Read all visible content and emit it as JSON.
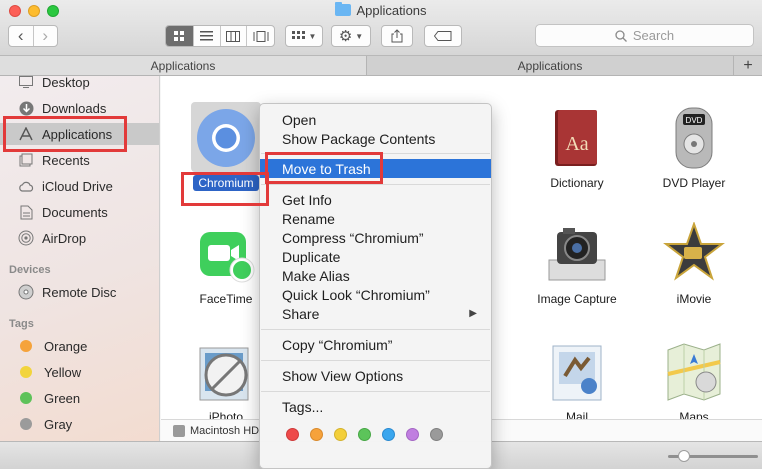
{
  "window": {
    "title": "Applications"
  },
  "toolbar": {
    "search_placeholder": "Search",
    "back_label": "‹",
    "forward_label": "›"
  },
  "tabs": [
    {
      "label": "Applications",
      "active": true
    },
    {
      "label": "Applications",
      "active": false
    }
  ],
  "tab_add_label": "+",
  "sidebar": {
    "favorites": [
      {
        "label": "Desktop",
        "icon": "desktop-icon"
      },
      {
        "label": "Downloads",
        "icon": "downloads-icon"
      },
      {
        "label": "Applications",
        "icon": "applications-icon",
        "selected": true
      },
      {
        "label": "Recents",
        "icon": "recents-icon"
      },
      {
        "label": "iCloud Drive",
        "icon": "cloud-icon"
      },
      {
        "label": "Documents",
        "icon": "documents-icon"
      },
      {
        "label": "AirDrop",
        "icon": "airdrop-icon"
      }
    ],
    "devices_heading": "Devices",
    "devices": [
      {
        "label": "Remote Disc",
        "icon": "disc-icon"
      }
    ],
    "tags_heading": "Tags",
    "tags": [
      {
        "label": "Orange",
        "color": "#f5a33b"
      },
      {
        "label": "Yellow",
        "color": "#f2d43c"
      },
      {
        "label": "Green",
        "color": "#5ec25a"
      },
      {
        "label": "Gray",
        "color": "#9b9b9b"
      }
    ]
  },
  "apps": [
    {
      "label": "Chromium",
      "selected": true
    },
    {
      "label": "Dictionary"
    },
    {
      "label": "DVD Player"
    },
    {
      "label": "FaceTime"
    },
    {
      "label": "Image Capture"
    },
    {
      "label": "iMovie"
    },
    {
      "label": "iPhoto"
    },
    {
      "label": "Mail"
    },
    {
      "label": "Maps"
    }
  ],
  "pathbar": {
    "disk": "Macintosh HD"
  },
  "context_menu": {
    "items": [
      {
        "label": "Open"
      },
      {
        "label": "Show Package Contents"
      },
      {
        "label": "Move to Trash",
        "highlighted": true
      },
      {
        "label": "Get Info"
      },
      {
        "label": "Rename"
      },
      {
        "label": "Compress “Chromium”"
      },
      {
        "label": "Duplicate"
      },
      {
        "label": "Make Alias"
      },
      {
        "label": "Quick Look “Chromium”"
      },
      {
        "label": "Share",
        "submenu": true
      },
      {
        "label": "Copy “Chromium”"
      },
      {
        "label": "Show View Options"
      },
      {
        "label": "Tags..."
      }
    ],
    "tag_colors": [
      "#ee4a4a",
      "#f6a23b",
      "#f3cf3a",
      "#5cc45a",
      "#3aa6ee",
      "#c07ee0",
      "#9a9a9a"
    ]
  }
}
